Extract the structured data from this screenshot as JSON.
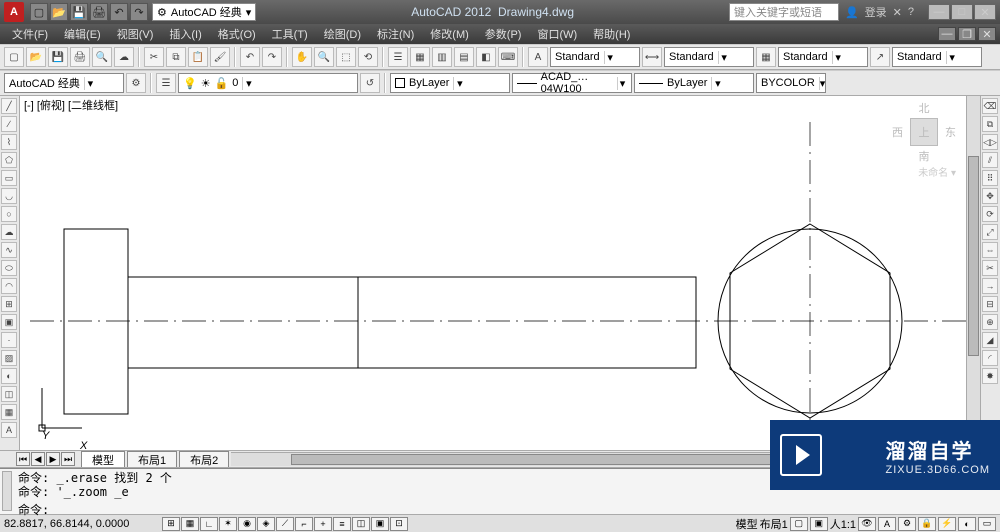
{
  "app": {
    "name": "AutoCAD 2012",
    "document": "Drawing4.dwg",
    "workspace_title": "AutoCAD 经典",
    "search_placeholder": "键入关键字或短语",
    "login": "登录"
  },
  "menu": {
    "file": "文件(F)",
    "edit": "编辑(E)",
    "view": "视图(V)",
    "insert": "插入(I)",
    "format": "格式(O)",
    "tools": "工具(T)",
    "draw": "绘图(D)",
    "dimension": "标注(N)",
    "modify": "修改(M)",
    "param": "参数(P)",
    "window": "窗口(W)",
    "help": "帮助(H)"
  },
  "styles": {
    "text_style": "Standard",
    "dim_style": "Standard",
    "table_style": "Standard",
    "mleader_style": "Standard"
  },
  "workspace_combo": "AutoCAD 经典",
  "layers": {
    "current": "0"
  },
  "properties": {
    "color": "ByLayer",
    "linetype_label": "ACAD_…04W100",
    "lineweight": "ByLayer",
    "plotstyle": "BYCOLOR"
  },
  "viewport": {
    "label": "[-] [俯视] [二维线框]"
  },
  "viewcube": {
    "n": "北",
    "s": "南",
    "e": "东",
    "w": "西",
    "top": "上",
    "wcs": "未命名 ▾"
  },
  "tabs": {
    "model": "模型",
    "layout1": "布局1",
    "layout2": "布局2"
  },
  "command": {
    "hist1": "命令: _.erase 找到 2 个",
    "hist2": "命令: '_.zoom _e",
    "prompt": "命令:"
  },
  "status": {
    "coords": "82.8817, 66.8144, 0.0000",
    "scale": "人1:1",
    "tabs_model": "模型",
    "tabs_layout1": "布局1"
  },
  "watermark": {
    "cn": "溜溜自学",
    "url": "ZIXUE.3D66.COM"
  },
  "ucs": {
    "x": "X",
    "y": "Y"
  }
}
